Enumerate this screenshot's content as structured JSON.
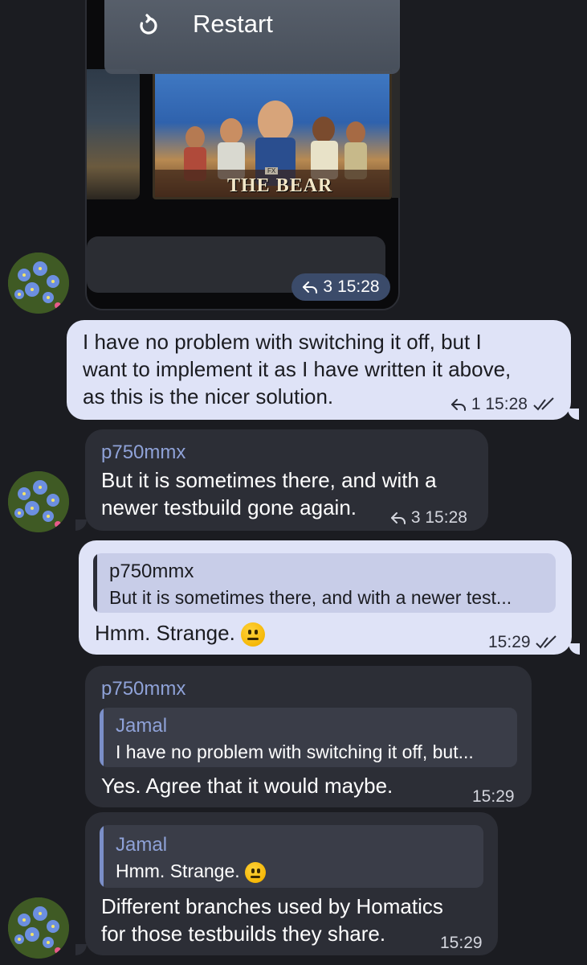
{
  "media": {
    "restart_label": "Restart",
    "poster_title": "THE BEAR",
    "poster_badge": "FX",
    "reply_count": "3",
    "time": "15:28"
  },
  "messages": [
    {
      "id": "m1",
      "direction": "outgoing",
      "text_lines": [
        "I have no problem with switching it off, but I",
        "want to implement it as I have written it above,",
        "as this is the nicer solution."
      ],
      "reply_count": "1",
      "time": "15:28",
      "read": true
    },
    {
      "id": "m2",
      "direction": "incoming",
      "sender": "p750mmx",
      "text_lines": [
        "But it is sometimes there, and with a",
        "newer testbuild gone again."
      ],
      "reply_count": "3",
      "time": "15:28"
    },
    {
      "id": "m3",
      "direction": "outgoing",
      "quote_sender": "p750mmx",
      "quote_text": "But it is sometimes there, and with a newer test...",
      "text": "Hmm. Strange.",
      "time": "15:29",
      "read": true
    },
    {
      "id": "m4",
      "direction": "incoming",
      "sender": "p750mmx",
      "quote_sender": "Jamal",
      "quote_text": "I have no problem with switching it off, but...",
      "text": "Yes. Agree that it would maybe.",
      "time": "15:29"
    },
    {
      "id": "m5",
      "direction": "incoming",
      "quote_sender": "Jamal",
      "quote_text": "Hmm. Strange.",
      "text_lines": [
        "Different branches used by Homatics",
        "for those testbuilds they share."
      ],
      "time": "15:29"
    }
  ],
  "icons": {
    "restart": "restart-icon",
    "reply": "reply-arrow-icon",
    "read": "double-check-icon",
    "emoji": "neutral-face-emoji",
    "avatar": "forget-me-not-flowers"
  },
  "colors": {
    "background": "#1b1c21",
    "outgoing_bubble": "#dfe3f7",
    "incoming_bubble": "#2c2e36",
    "sender_name": "#8fa2d8",
    "meta_pill": "#3b4b6a"
  }
}
